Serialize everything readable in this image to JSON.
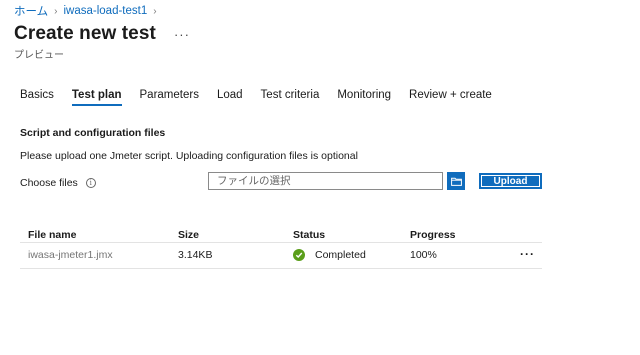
{
  "breadcrumb": {
    "home": "ホーム",
    "resource": "iwasa-load-test1"
  },
  "page": {
    "title": "Create new test",
    "subtitle": "プレビュー",
    "more": "···"
  },
  "tabs": [
    {
      "label": "Basics",
      "active": false
    },
    {
      "label": "Test plan",
      "active": true
    },
    {
      "label": "Parameters",
      "active": false
    },
    {
      "label": "Load",
      "active": false
    },
    {
      "label": "Test criteria",
      "active": false
    },
    {
      "label": "Monitoring",
      "active": false
    },
    {
      "label": "Review + create",
      "active": false
    }
  ],
  "section": {
    "title": "Script and configuration files",
    "description": "Please upload one Jmeter script. Uploading configuration files is optional"
  },
  "upload": {
    "choose_label": "Choose files",
    "info_icon": "info-icon",
    "placeholder": "ファイルの選択",
    "folder_icon": "folder-icon",
    "button_label": "Upload"
  },
  "table": {
    "headers": [
      "File name",
      "Size",
      "Status",
      "Progress"
    ],
    "rows": [
      {
        "file_name": "iwasa-jmeter1.jmx",
        "size": "3.14KB",
        "status": "Completed",
        "progress": "100%",
        "more": "···"
      }
    ]
  },
  "colors": {
    "accent": "#0f6cbd",
    "success": "#5a9e1a",
    "muted_text": "#767676"
  }
}
